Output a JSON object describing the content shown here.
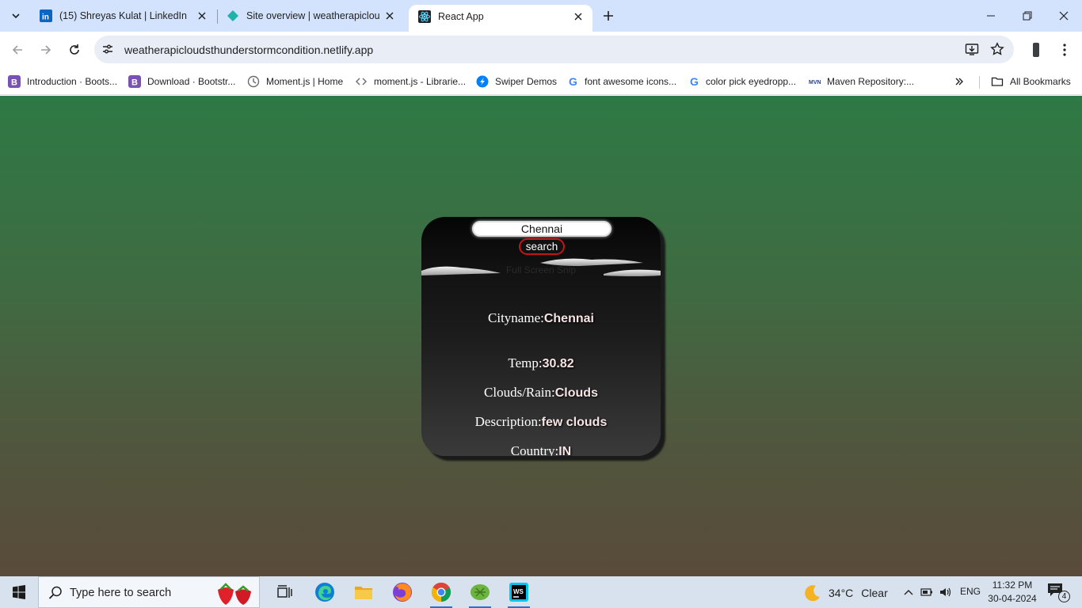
{
  "browser": {
    "tabs": [
      {
        "title": "(15) Shreyas Kulat | LinkedIn",
        "icon": "linkedin-icon",
        "active": false
      },
      {
        "title": "Site overview | weatherapicloud",
        "icon": "netlify-icon",
        "active": false
      },
      {
        "title": "React App",
        "icon": "react-icon",
        "active": true
      }
    ],
    "address": "weatherapicloudsthunderstormcondition.netlify.app",
    "bookmarks": [
      {
        "label": "Introduction · Boots...",
        "icon": "bootstrap-icon"
      },
      {
        "label": "Download · Bootstr...",
        "icon": "bootstrap-icon"
      },
      {
        "label": "Moment.js | Home",
        "icon": "clock-icon"
      },
      {
        "label": "moment.js - Librarie...",
        "icon": "code-icon"
      },
      {
        "label": "Swiper Demos",
        "icon": "swiper-icon"
      },
      {
        "label": "font awesome icons...",
        "icon": "google-icon"
      },
      {
        "label": "color pick eyedropp...",
        "icon": "google-icon"
      },
      {
        "label": "Maven Repository:...",
        "icon": "maven-icon"
      }
    ],
    "all_bookmarks": "All Bookmarks"
  },
  "app": {
    "city_input": "Chennai",
    "search_label": "search",
    "image_alt": "Full Screen Snip",
    "fields": [
      {
        "label": "Cityname:",
        "value": "Chennai"
      },
      {
        "label": "Temp:",
        "value": "30.82"
      },
      {
        "label": "Clouds/Rain:",
        "value": "Clouds"
      },
      {
        "label": "Description:",
        "value": "few clouds"
      },
      {
        "label": "Country:",
        "value": "IN"
      }
    ]
  },
  "taskbar": {
    "search_placeholder": "Type here to search",
    "weather_temp": "34°C",
    "weather_cond": "Clear",
    "language": "ENG",
    "time": "11:32 PM",
    "date": "30-04-2024",
    "notification_count": "4"
  },
  "colors": {
    "tab_strip": "#d3e3fd",
    "gradient_top": "#2e7945",
    "gradient_bottom": "#5a4a3a",
    "search_border": "#c21515"
  }
}
